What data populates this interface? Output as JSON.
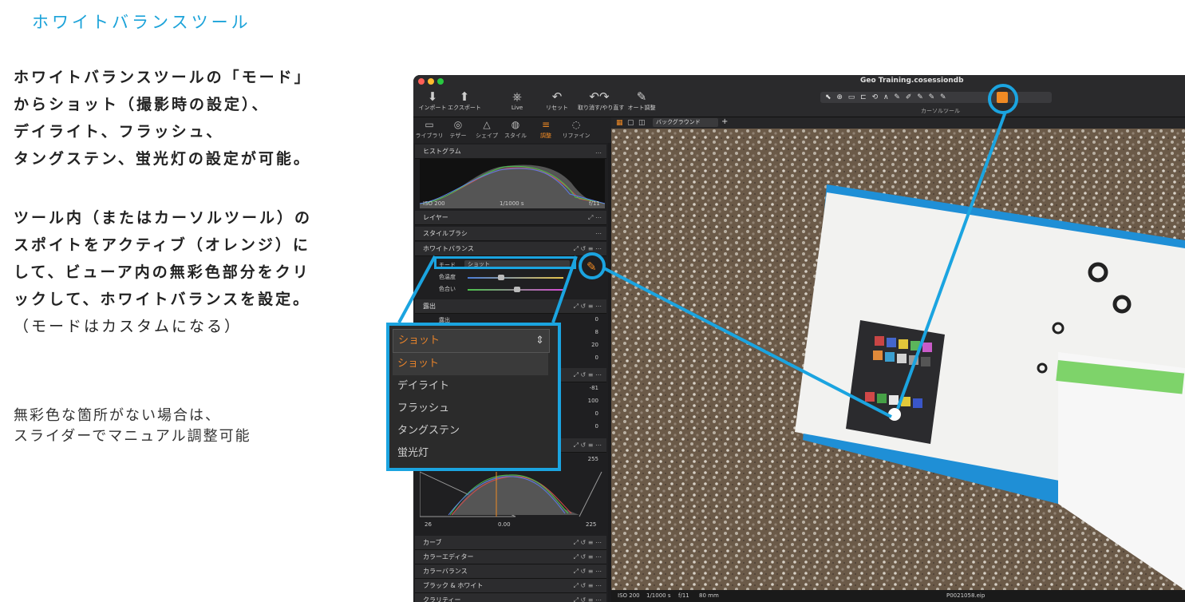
{
  "heading": "ホワイトバランスツール",
  "para1": [
    "ホワイトバランスツールの「モード」",
    "からショット（撮影時の設定）、",
    "デイライト、フラッシュ、",
    "タングステン、蛍光灯の設定が可能。"
  ],
  "para2": [
    "ツール内（またはカーソルツール）の",
    "スポイトをアクティブ（オレンジ）に",
    "して、ビューア内の無彩色部分をクリ",
    "ックして、ホワイトバランスを設定。",
    "（モードはカスタムになる）"
  ],
  "note": [
    "無彩色な箇所がない場合は、",
    "スライダーでマニュアル調整可能"
  ],
  "window": {
    "title": "Geo Training.cosessiondb",
    "toolbar": [
      {
        "icon": "import-icon",
        "glyph": "⬇",
        "label": "インポート"
      },
      {
        "icon": "export-icon",
        "glyph": "⬆",
        "label": "エクスポート"
      },
      {
        "icon": "live-icon",
        "glyph": "⎈",
        "label": "Live"
      },
      {
        "icon": "reset-icon",
        "glyph": "↶",
        "label": "リセット"
      },
      {
        "icon": "undo-redo-icon",
        "glyph": "↶↷",
        "label": "取り消す/やり直す"
      },
      {
        "icon": "auto-adjust-icon",
        "glyph": "✎",
        "label": "オート調整"
      }
    ],
    "cursor_tools_label": "カーソルツール",
    "cursor_tools_glyphs": "⬉ ⊕ ▭ ⊏ ⟲ ∧ ✎ ✐ ✎ ✎ ✎",
    "tabs": [
      {
        "icon": "library-icon",
        "glyph": "▭",
        "label": "ライブラリ"
      },
      {
        "icon": "tether-icon",
        "glyph": "◎",
        "label": "テザー"
      },
      {
        "icon": "shape-icon",
        "glyph": "△",
        "label": "シェイプ"
      },
      {
        "icon": "style-icon",
        "glyph": "◍",
        "label": "スタイル"
      },
      {
        "icon": "adjust-icon",
        "glyph": "≡",
        "label": "調整"
      },
      {
        "icon": "refine-icon",
        "glyph": "◌",
        "label": "リファイン"
      }
    ],
    "viewer_bar": {
      "background_label": "バックグラウンド"
    },
    "panel": {
      "histogram": {
        "title": "ヒストグラム",
        "iso": "ISO 200",
        "shutter": "1/1000 s",
        "aperture": "f/11"
      },
      "layers": "レイヤー",
      "style_brush": "スタイルブラシ",
      "white_balance": {
        "title": "ホワイトバランス",
        "mode_label": "モード",
        "mode_value": "ショット",
        "temp_label": "色温度",
        "tint_label": "色合い"
      },
      "exposure": {
        "title": "露出",
        "rows": [
          {
            "k": "露出",
            "v": "0"
          },
          {
            "k": "",
            "v": "8"
          },
          {
            "k": "",
            "v": "20"
          },
          {
            "k": "",
            "v": "0"
          }
        ]
      },
      "hdr_values": [
        "-81",
        "100",
        "0",
        "0"
      ],
      "levels": {
        "top_value": "255",
        "low": "26",
        "mid": "0.00",
        "high": "225"
      },
      "bottom_sections": [
        "カーブ",
        "カラーエディター",
        "カラーバランス",
        "ブラック & ホワイト",
        "クラリティー"
      ]
    },
    "status": {
      "iso": "ISO 200",
      "shutter": "1/1000 s",
      "aperture": "f/11",
      "focal": "80 mm",
      "filename": "P0021058.eip"
    }
  },
  "dropdown": {
    "current": "ショット",
    "options": [
      "ショット",
      "デイライト",
      "フラッシュ",
      "タングステン",
      "蛍光灯"
    ]
  },
  "colors": {
    "accent": "#1ca3d9",
    "active_orange": "#f08a24"
  }
}
